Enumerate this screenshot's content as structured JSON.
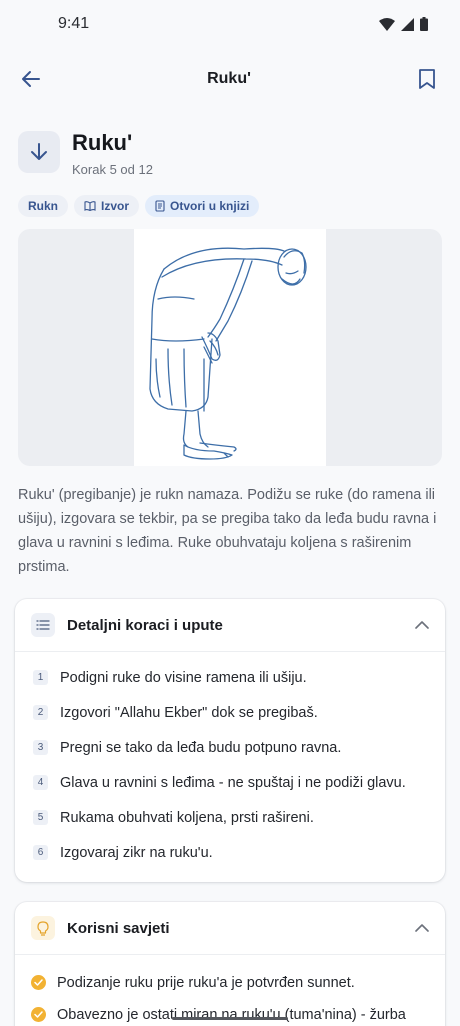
{
  "status_bar": {
    "time": "9:41"
  },
  "topbar": {
    "title": "Ruku'",
    "back_icon": "arrow-left-icon",
    "bookmark_icon": "bookmark-icon"
  },
  "header": {
    "title": "Ruku'",
    "subtitle": "Korak 5 od 12",
    "icon": "arrow-down-icon"
  },
  "chips": [
    {
      "label": "Rukn",
      "icon": ""
    },
    {
      "label": "Izvor",
      "icon": "book-open-icon"
    },
    {
      "label": "Otvori u knjizi",
      "icon": "document-icon"
    }
  ],
  "description": "Ruku' (pregibanje) je rukn namaza. Podižu se ruke (do ramena ili ušiju), izgovara se tekbir, pa se pregiba tako da leđa budu ravna i glava u ravnini s leđima. Ruke obuhvataju koljena s raširenim prstima.",
  "steps_card": {
    "title": "Detaljni koraci i upute",
    "icon": "list-icon",
    "steps": [
      {
        "num": "1",
        "text": "Podigni ruke do visine ramena ili ušiju."
      },
      {
        "num": "2",
        "text": "Izgovori \"Allahu Ekber\" dok se pregibaš."
      },
      {
        "num": "3",
        "text": "Pregni se tako da leđa budu potpuno ravna."
      },
      {
        "num": "4",
        "text": "Glava u ravnini s leđima - ne spuštaj i ne podiži glavu."
      },
      {
        "num": "5",
        "text": "Rukama obuhvati koljena, prsti rašireni."
      },
      {
        "num": "6",
        "text": "Izgovaraj zikr na ruku'u."
      }
    ]
  },
  "tips_card": {
    "title": "Korisni savjeti",
    "icon": "lightbulb-icon",
    "tips": [
      {
        "text": "Podizanje ruku prije ruku'a je potvrđen sunnet."
      },
      {
        "text": "Obavezno je ostati miran na ruku'u (tuma'nina) - žurba može poništiti namaz."
      }
    ]
  },
  "colors": {
    "accent": "#38558f",
    "tip": "#f2b233",
    "illustration_line": "#3d6ea8"
  }
}
